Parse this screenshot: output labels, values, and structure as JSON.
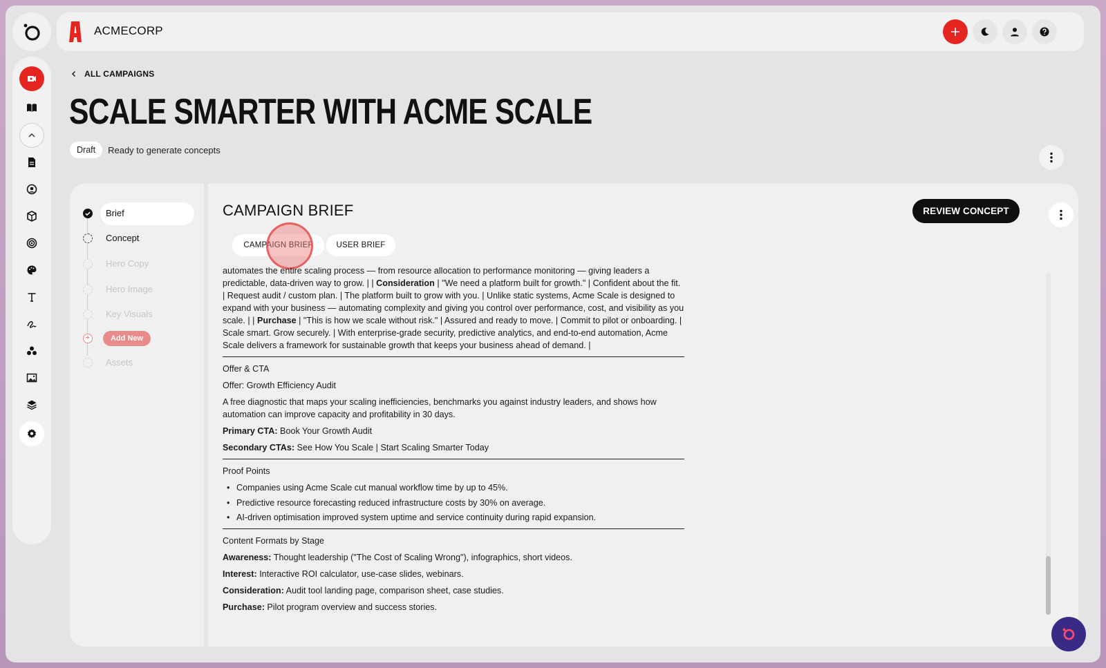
{
  "brand": {
    "name": "ACMECORP",
    "accent": "#e52520"
  },
  "header": {
    "back_label": "ALL CAMPAIGNS",
    "title": "SCALE SMARTER WITH ACME SCALE",
    "status_badge": "Draft",
    "status_text": "Ready to generate concepts"
  },
  "steps": [
    {
      "label": "Brief",
      "state": "done"
    },
    {
      "label": "Concept",
      "state": "pending"
    },
    {
      "label": "Hero Copy",
      "state": "disabled"
    },
    {
      "label": "Hero Image",
      "state": "disabled"
    },
    {
      "label": "Key Visuals",
      "state": "disabled"
    },
    {
      "label": "Add New",
      "state": "add"
    },
    {
      "label": "Assets",
      "state": "disabled"
    }
  ],
  "main": {
    "title": "CAMPAIGN BRIEF",
    "review_button": "REVIEW CONCEPT",
    "tabs": [
      "CAMPAIGN BRIEF",
      "USER BRIEF"
    ]
  },
  "brief": {
    "journey": {
      "p1": "automates the entire scaling process — from resource allocation to performance monitoring — giving leaders a predictable, data-driven way to grow. | |",
      "consideration_label": "Consideration",
      "p2": "| \"We need a platform built for growth.\" | Confident about the fit. | Request audit / custom plan. | The platform built to grow with you. | Unlike static systems, Acme Scale is designed to expand with your business — automating complexity and giving you control over performance, cost, and visibility as you scale. | |",
      "purchase_label": "Purchase",
      "p3": "| \"This is how we scale without risk.\" | Assured and ready to move. | Commit to pilot or onboarding. | Scale smart. Grow securely. | With enterprise-grade security, predictive analytics, and end-to-end automation, Acme Scale delivers a framework for sustainable growth that keeps your business ahead of demand. |"
    },
    "offer": {
      "heading": "Offer & CTA",
      "offer_title": "Offer: Growth Efficiency Audit",
      "description": "A free diagnostic that maps your scaling inefficiencies, benchmarks you against industry leaders, and shows how automation can improve capacity and profitability in 30 days.",
      "primary_label": "Primary CTA:",
      "primary_value": "Book Your Growth Audit",
      "secondary_label": "Secondary CTAs:",
      "secondary_value": "See How You Scale | Start Scaling Smarter Today"
    },
    "proof": {
      "heading": "Proof Points",
      "items": [
        "Companies using Acme Scale cut manual workflow time by up to 45%.",
        "Predictive resource forecasting reduced infrastructure costs by 30% on average.",
        "AI-driven optimisation improved system uptime and service continuity during rapid expansion."
      ]
    },
    "formats": {
      "heading": "Content Formats by Stage",
      "rows": [
        {
          "label": "Awareness:",
          "value": "Thought leadership (\"The Cost of Scaling Wrong\"), infographics, short videos."
        },
        {
          "label": "Interest:",
          "value": "Interactive ROI calculator, use-case slides, webinars."
        },
        {
          "label": "Consideration:",
          "value": "Audit tool landing page, comparison sheet, case studies."
        },
        {
          "label": "Purchase:",
          "value": "Pilot program overview and success stories."
        }
      ]
    }
  },
  "icons": {
    "rail": [
      "campaigns-icon",
      "book-icon",
      "chevron-up-icon",
      "document-icon",
      "persona-icon",
      "cube-icon",
      "target-icon",
      "palette-icon",
      "typography-icon",
      "signature-icon",
      "audience-icon",
      "image-icon",
      "layers-icon",
      "settings-icon"
    ],
    "top": [
      "plus-icon",
      "moon-icon",
      "user-icon",
      "help-icon"
    ]
  }
}
